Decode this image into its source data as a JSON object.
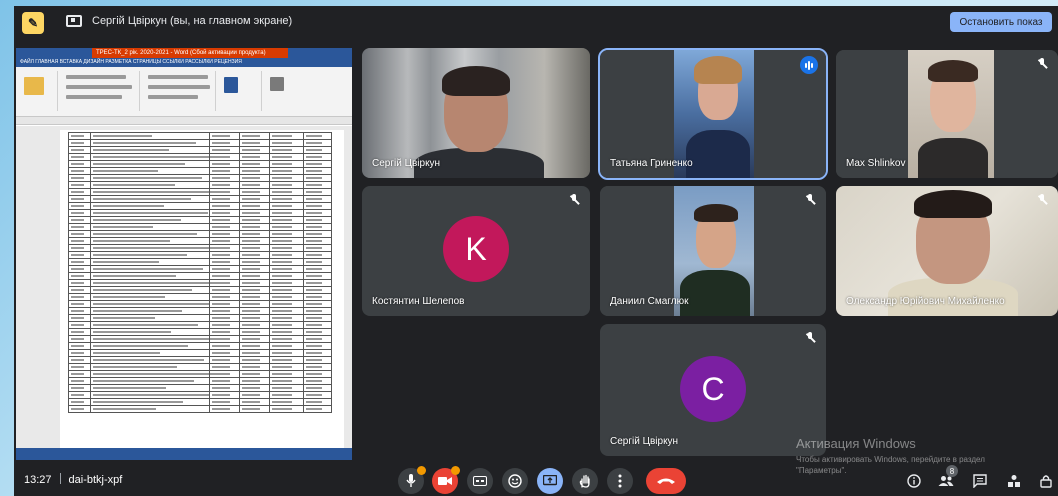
{
  "topbar": {
    "present_badge": "✎",
    "presenting_title": "Сергій Цвіркун (вы, на главном экране)",
    "stop_button": "Остановить показ"
  },
  "shared_screen": {
    "window_title": "ТРЕС-ТК_2 рік. 2020-2021 - Word (Сбой активации продукта)",
    "menu": "ФАЙЛ  ГЛАВНАЯ  ВСТАВКА  ДИЗАЙН  РАЗМЕТКА СТРАНИЦЫ  ССЫЛКИ  РАССЫЛКИ  РЕЦЕНЗИЯ"
  },
  "participants": [
    {
      "name": "Сергій Цвіркун",
      "muted": false
    },
    {
      "name": "Татьяна Гриненко",
      "speaking": true
    },
    {
      "name": "Max Shlinkov",
      "muted": true
    },
    {
      "name": "Костянтин Шелепов",
      "muted": true,
      "initial": "K",
      "color": "#c2185b"
    },
    {
      "name": "Даниил Смаглюк",
      "muted": true
    },
    {
      "name": "Олександр Юрійович Михайленко",
      "muted": true
    },
    {
      "name": "Сергій Цвіркун",
      "muted": true,
      "initial": "C",
      "color": "#7b1fa2"
    }
  ],
  "activation": {
    "title": "Активация Windows",
    "line1": "Чтобы активировать Windows, перейдите в раздел",
    "line2": "\"Параметры\"."
  },
  "bottombar": {
    "time": "13:27",
    "meeting_code": "dai-btkj-xpf",
    "people_count": "8"
  },
  "icons": {
    "mic": "mic-icon",
    "camera": "camera-icon",
    "captions": "cc-icon",
    "emoji": "emoji-icon",
    "present": "present-icon",
    "hand": "hand-icon",
    "more": "more-icon",
    "end_call": "end-call-icon"
  }
}
